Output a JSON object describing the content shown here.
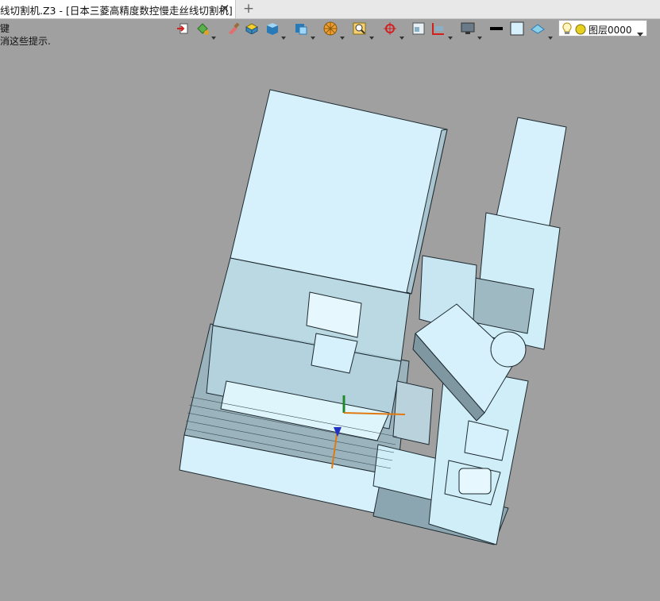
{
  "tab": {
    "title": "线切割机.Z3 - [日本三菱高精度数控慢走丝线切割机]",
    "close_glyph": "✕",
    "new_tab_glyph": "+"
  },
  "hints": {
    "line1": "键",
    "line2": "消这些提示."
  },
  "layer": {
    "name": "图层0000"
  },
  "toolbar_icons": [
    "import-icon",
    "paint-bucket-icon",
    "brush-icon",
    "solid-yellow-icon",
    "cube-blue-icon",
    "cube-front-icon",
    "wheel-icon",
    "zoom-fit-icon",
    "target-icon",
    "screen-icon",
    "section-icon",
    "monitor-icon",
    "line-width-icon",
    "fill-color-icon",
    "render-icon",
    "lightbulb-icon",
    "layer-color-icon"
  ],
  "colors": {
    "background": "#a0a0a0",
    "model_face": "#cfeef8",
    "model_side": "#93aeb8",
    "model_edge": "#1e2a30"
  }
}
